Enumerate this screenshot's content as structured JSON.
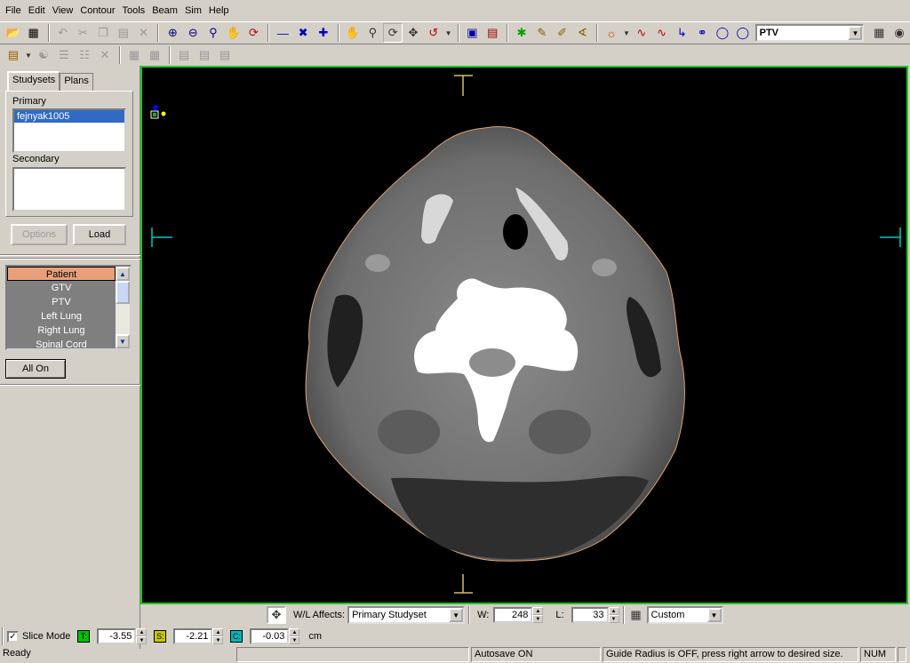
{
  "menu": [
    "File",
    "Edit",
    "View",
    "Contour",
    "Tools",
    "Beam",
    "Sim",
    "Help"
  ],
  "toolbar": {
    "roi_combo_value": "PTV"
  },
  "left_panel": {
    "tabs": [
      "Studysets",
      "Plans"
    ],
    "primary_label": "Primary",
    "primary_items": [
      "fejnyak1005"
    ],
    "secondary_label": "Secondary",
    "options_button": "Options",
    "load_button": "Load",
    "roi_items": [
      "Patient",
      "GTV",
      "PTV",
      "Left Lung",
      "Right Lung",
      "Spinal Cord"
    ],
    "selected_roi": "Patient",
    "all_on_button": "All On"
  },
  "wl": {
    "affects_label": "W/L Affects:",
    "affects_value": "Primary Studyset",
    "w_label": "W:",
    "w_value": "248",
    "l_label": "L:",
    "l_value": "33",
    "preset_value": "Custom"
  },
  "slice": {
    "mode_label": "Slice Mode",
    "mode_checked": true,
    "t_label": "T:",
    "t_value": "-3.55",
    "t_color": "#00c000",
    "s_label": "S:",
    "s_value": "-2.21",
    "s_color": "#c8c800",
    "c_label": "C:",
    "c_value": "-0.03",
    "c_color": "#00b8b8",
    "unit": "cm"
  },
  "statusbar": {
    "ready": "Ready",
    "autosave": "Autosave ON",
    "guide": "Guide Radius is OFF, press right arrow to desired size.",
    "num": "NUM"
  },
  "colors": {
    "viewer_border": "#1ec81e",
    "selection": "#316ac5",
    "roi_selected": "#e8a07a",
    "crosshair": "#00c8c8",
    "crosshair_top": "#d4c060"
  }
}
